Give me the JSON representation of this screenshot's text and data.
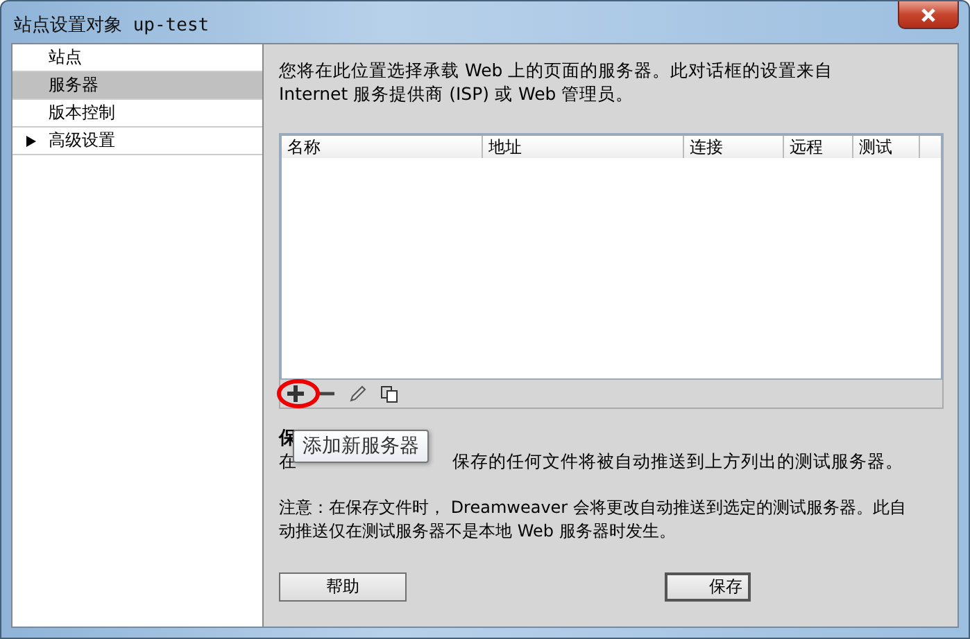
{
  "window": {
    "title": "站点设置对象 up-test"
  },
  "sidebar": {
    "items": [
      {
        "label": "站点",
        "selected": false,
        "expandable": false
      },
      {
        "label": "服务器",
        "selected": true,
        "expandable": false
      },
      {
        "label": "版本控制",
        "selected": false,
        "expandable": false
      },
      {
        "label": "高级设置",
        "selected": false,
        "expandable": true
      }
    ]
  },
  "description": "您将在此位置选择承载 Web 上的页面的服务器。此对话框的设置来自 Internet 服务提供商 (ISP) 或 Web 管理员。",
  "table": {
    "columns": [
      "名称",
      "地址",
      "连接",
      "远程",
      "测试"
    ]
  },
  "tooltip": "添加新服务器",
  "auto_push": {
    "heading": "保",
    "text_start": "在",
    "text_rest": "保存的任何文件将被自动推送到上方列出的测试服务器。"
  },
  "note": "注意：在保存文件时， Dreamweaver 会将更改自动推送到选定的测试服务器。此自动推送仅在测试服务器不是本地 Web 服务器时发生。",
  "buttons": [
    {
      "label": "帮助",
      "kind": "plain"
    },
    {
      "label": "保存",
      "kind": "default"
    }
  ]
}
